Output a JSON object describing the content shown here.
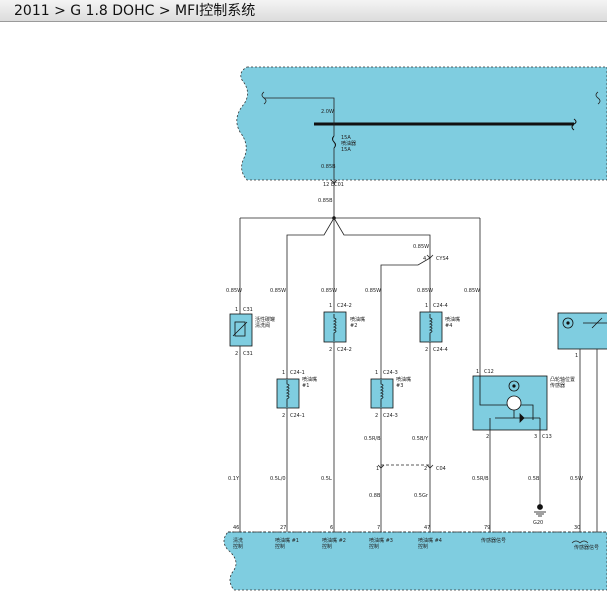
{
  "breadcrumb": "2011 > G 1.8 DOHC > MFI控制系统",
  "colors": {
    "panel": "#7fcde0",
    "module": "#7fcde0",
    "wire": "#222222",
    "background": "#ffffff"
  },
  "top_panel": {
    "wire_label": "2.0W",
    "fuse_text": [
      "15A",
      "喷油器",
      "15A"
    ],
    "wire_below_label": "0.85B",
    "connector_label": "12 EC01",
    "after_connector_label": "0.85B"
  },
  "branches": {
    "purge_valve": {
      "wire_label": "0.85W",
      "pin_top": "1",
      "conn_top": "C31",
      "name": [
        "活性碳罐",
        "清洗阀"
      ],
      "pin_bottom": "2",
      "conn_bottom": "C31",
      "wire_bottom_label": "0.1Y",
      "ecu_pin": "46",
      "ecu_label": [
        "清洗",
        "控制"
      ]
    },
    "injector1": {
      "wire_label": "0.85W",
      "pin_top": "1",
      "conn_top": "C24-1",
      "name": [
        "喷油嘴",
        "#1"
      ],
      "pin_bottom": "2",
      "conn_bottom": "C24-1",
      "wire_bottom_label": "0.5L/0",
      "ecu_pin": "27",
      "ecu_label": [
        "喷油嘴 #1",
        "控制"
      ]
    },
    "injector2": {
      "wire_label": "0.85W",
      "pin_top": "1",
      "conn_top": "C24-2",
      "name": [
        "喷油嘴",
        "#2"
      ],
      "pin_bottom": "2",
      "conn_bottom": "C24-2",
      "wire_bottom_label": "0.5L",
      "ecu_pin": "6",
      "ecu_label": [
        "喷油嘴 #2",
        "控制"
      ]
    },
    "injector3": {
      "wire_label": "0.85W",
      "pin_top": "1",
      "conn_top": "C24-3",
      "name": [
        "喷油嘴",
        "#3"
      ],
      "pin_bottom": "2",
      "conn_bottom": "C24-3",
      "wire_mid_label": "0.5R/B",
      "wire_bottom_label": "0.8B",
      "ecu_pin": "7",
      "ecu_label": [
        "喷油嘴 #3",
        "控制"
      ]
    },
    "injector4": {
      "wire_label": "0.85W",
      "pin_top": "1",
      "conn_top": "C24-4",
      "name": [
        "喷油嘴",
        "#4"
      ],
      "pin_bottom": "2",
      "conn_bottom": "C24-4",
      "wire_mid_label": "0.5B/Y",
      "wire_bottom_label": "0.5Gr",
      "ecu_pin": "47",
      "ecu_label": [
        "喷油嘴 #4",
        "控制"
      ]
    },
    "splice": {
      "label": "0.85W",
      "pin": "4",
      "conn": "CYS4"
    },
    "connector_c04": {
      "pin_left": "1",
      "pin_right": "2",
      "conn": "C04"
    },
    "camshaft_sensor": {
      "wire_label": "0.85W",
      "pin_top": "1",
      "conn_top": "C12",
      "name": [
        "凸轮轴位置",
        "传感器"
      ],
      "pin_bottom_left": "2",
      "pin_bottom_right": "3",
      "conn_bottom": "C13",
      "wire_bottom_label": "0.5R/B",
      "ecu_pin": "79",
      "ecu_label": [
        "传感器信号"
      ]
    },
    "ground": {
      "wire_label": "0.5B",
      "name": "G20"
    },
    "right_module": {
      "pin_bottom": "1",
      "wire_bottom_label": "0.5W",
      "ecu_pin": "30",
      "ecu_label": [
        "传感器信号"
      ]
    }
  }
}
